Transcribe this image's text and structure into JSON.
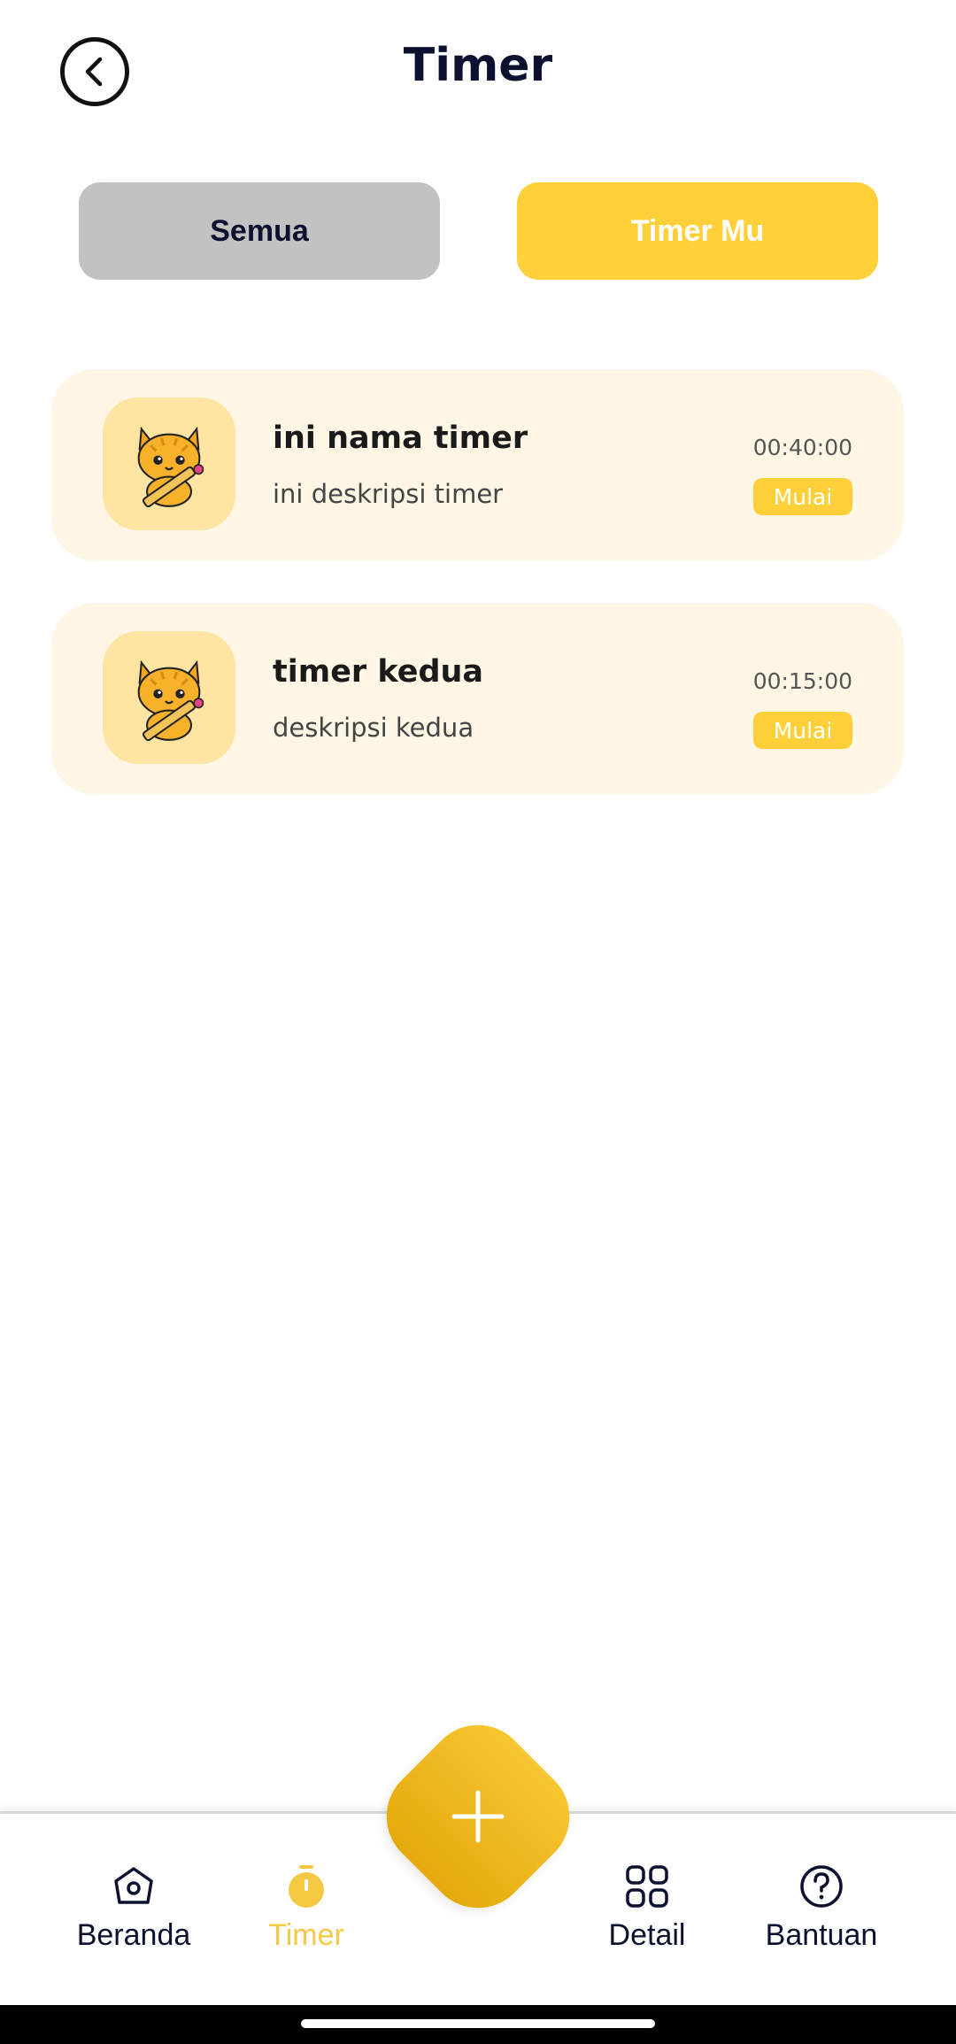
{
  "header": {
    "title": "Timer",
    "back_icon": "chevron-left-icon"
  },
  "tabs": [
    {
      "label": "Semua",
      "active": false
    },
    {
      "label": "Timer Mu",
      "active": true
    }
  ],
  "timers": [
    {
      "name": "ini nama timer",
      "description": "ini deskripsi timer",
      "duration": "00:40:00",
      "action_label": "Mulai",
      "icon": "cat-pencil-icon"
    },
    {
      "name": "timer kedua",
      "description": "deskripsi kedua",
      "duration": "00:15:00",
      "action_label": "Mulai",
      "icon": "cat-pencil-icon"
    }
  ],
  "fab": {
    "icon": "plus-icon"
  },
  "bottom_nav": {
    "items": [
      {
        "label": "Beranda",
        "icon": "home-icon",
        "active": false
      },
      {
        "label": "Timer",
        "icon": "stopwatch-icon",
        "active": true
      },
      {
        "label": "Detail",
        "icon": "grid-icon",
        "active": false
      },
      {
        "label": "Bantuan",
        "icon": "help-icon",
        "active": false
      }
    ]
  },
  "colors": {
    "accent": "#ffd03a",
    "card_bg": "#fff6e6",
    "thumb_bg": "#ffe4a3",
    "tab_inactive": "#c2c2c2",
    "text_dark": "#0d1130"
  }
}
